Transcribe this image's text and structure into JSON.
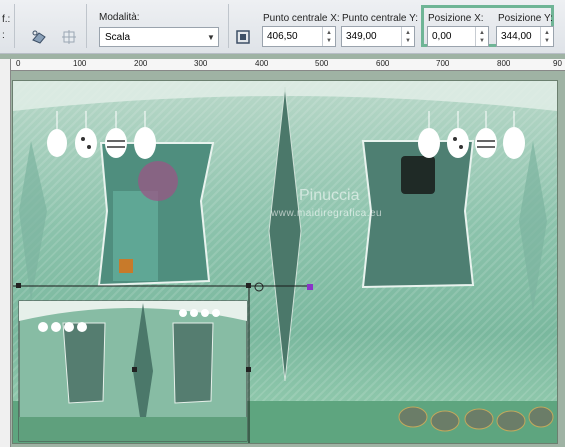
{
  "toolbar": {
    "truncated_label": "f.:",
    "mode_label": "Modalità:",
    "mode_value": "Scala",
    "center_x_label": "Punto centrale X:",
    "center_x_value": "406,50",
    "center_y_label": "Punto centrale Y:",
    "center_y_value": "349,00",
    "pos_x_label": "Posizione X:",
    "pos_x_value": "0,00",
    "pos_y_label": "Posizione Y:",
    "pos_y_value": "344,00"
  },
  "ruler": {
    "ticks": [
      "0",
      "100",
      "200",
      "300",
      "400",
      "500",
      "600",
      "700",
      "800",
      "90"
    ]
  },
  "canvas": {
    "watermark_title": "Pinuccia",
    "watermark_url": "www.maidiregrafica.eu"
  },
  "colors": {
    "highlight": "#6fb596",
    "canvas_green": "#8cc3ac"
  }
}
